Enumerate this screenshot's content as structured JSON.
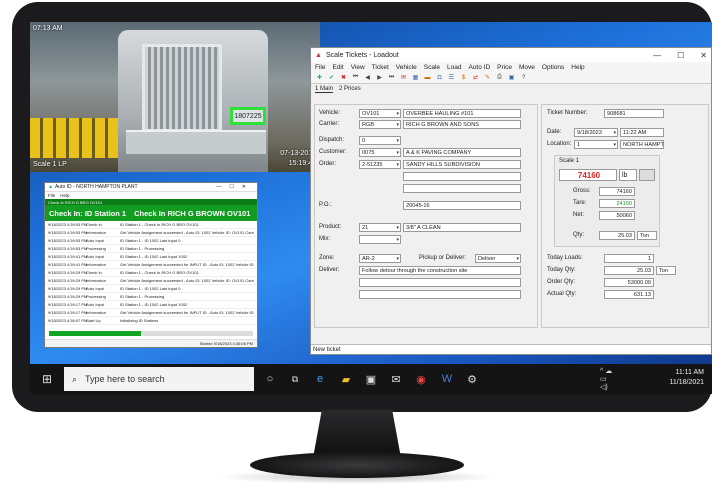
{
  "camera": {
    "timestamp_top": "07:13 AM",
    "date": "07-13-2018",
    "time": "15:19:41",
    "label": "Scale 1 LP",
    "plate": "1807225"
  },
  "autoid": {
    "title": "Auto ID - NORTH HAMPTON PLANT",
    "menu": [
      "File",
      "Help"
    ],
    "strip": "Check In RICH G BRO OV101",
    "banner_left": "Check In:  ID Station 1",
    "banner_right": "Check In RICH G BROWN OV101",
    "log": [
      [
        "9/18/2023 4:39:53 PM",
        "Check In",
        "ID Station 1 - Check In RICH G BRO OV101"
      ],
      [
        "9/18/2023 4:39:53 PM",
        "Information",
        "Get Vehicle Assignment succeeded - Auto ID: 1002 Vehicle ID: OV101 Carrie"
      ],
      [
        "9/18/2023 4:39:53 PM",
        "Auto Input",
        "ID Station 1 - ID 1002 Last Input 0"
      ],
      [
        "9/18/2023 4:39:53 PM",
        "Processing",
        "ID Station 1 - Processing"
      ],
      [
        "9/18/2023 4:39:41 PM",
        "Auto Input",
        "ID Station 1 - ID 1002 Last Input 1002"
      ],
      [
        "9/18/2023 4:39:41 PM",
        "Information",
        "Get Vehicle Assignment succeeded for INPUT ID - Auto ID: 1002 Vehicle ID: "
      ],
      [
        "9/18/2023 4:39:29 PM",
        "Check In",
        "ID Station 1 - Check In RICH G BRO OV101"
      ],
      [
        "9/18/2023 4:39:29 PM",
        "Information",
        "Get Vehicle Assignment succeeded - Auto ID: 1002 Vehicle ID: OV101 Carrie"
      ],
      [
        "9/18/2023 4:39:29 PM",
        "Auto Input",
        "ID Station 1 - ID 1002 Last Input 0"
      ],
      [
        "9/18/2023 4:39:29 PM",
        "Processing",
        "ID Station 1 - Processing"
      ],
      [
        "9/18/2023 4:39:17 PM",
        "Auto Input",
        "ID Station 1 - ID 1002 Last Input 1002"
      ],
      [
        "9/18/2023 4:39:17 PM",
        "Information",
        "Get Vehicle Assignment succeeded for INPUT ID - Auto ID: 1002 Vehicle ID: "
      ],
      [
        "9/18/2023 4:36:07 PM",
        "Start Up",
        "Initializing ID Stations"
      ]
    ],
    "progress_fraction": 0.45,
    "status": "Started 9/18/2023 4:36:06 PM"
  },
  "scale": {
    "title": "Scale Tickets - Loadout",
    "window_controls": [
      "—",
      "☐",
      "✕"
    ],
    "menu": [
      "File",
      "Edit",
      "View",
      "Ticket",
      "Vehicle",
      "Scale",
      "Load",
      "Auto ID",
      "Price",
      "Move",
      "Options",
      "Help"
    ],
    "tabs": [
      "1 Main",
      "2 Prices"
    ],
    "labels": {
      "vehicle": "Vehicle:",
      "carrier": "Carrier:",
      "dispatch": "Dispatch:",
      "customer": "Customer:",
      "order": "Order:",
      "po": "P.O.:",
      "product": "Product:",
      "mix": "Mix:",
      "zone": "Zone:",
      "pickup": "Pickup or Deliver:",
      "deliver": "Deliver:",
      "ticket_number": "Ticket Number:",
      "date": "Date:",
      "location": "Location:",
      "scale1": "Scale 1",
      "gross": "Gross:",
      "tare": "Tare:",
      "net": "Net:",
      "qty": "Qty:",
      "today_loads": "Today Loads:",
      "today_qty": "Today Qty:",
      "order_qty": "Order Qty:",
      "actual_qty": "Actual Qty:"
    },
    "values": {
      "vehicle": "OV101",
      "vehicle_name": "OVERBEE HAULING #101",
      "carrier": "RGB",
      "carrier_name": "RICH G BROWN AND SONS",
      "dispatch": "0",
      "customer": "0075",
      "customer_name": "A & K PAVING COMPANY",
      "order": "2-51235",
      "order_name": "SANDY HILLS SUBDIVISION",
      "po": "20045-16",
      "product": "21",
      "product_name": "3/8\" A CLEAN",
      "mix": "",
      "zone": "AR-2",
      "pickup": "Deliver",
      "deliver_note": "Follow detour through the construction site",
      "ticket_number": "908681",
      "date": "9/18/2023",
      "time": "11:22 AM",
      "location": "1",
      "location_name": "NORTH HAMPT",
      "scale_weight": "74160",
      "scale_unit": "lb",
      "gross": "74160",
      "tare": "24100",
      "net": "50060",
      "qty": "25.03",
      "qty_unit": "Ton",
      "today_loads": "1",
      "today_qty": "25.03",
      "today_unit": "Ton",
      "order_qty": "53000.00",
      "actual_qty": "631.13"
    },
    "footer": "New ticket"
  },
  "taskbar": {
    "search_placeholder": "Type here to search",
    "time": "11:11 AM",
    "date": "11/18/2021"
  }
}
